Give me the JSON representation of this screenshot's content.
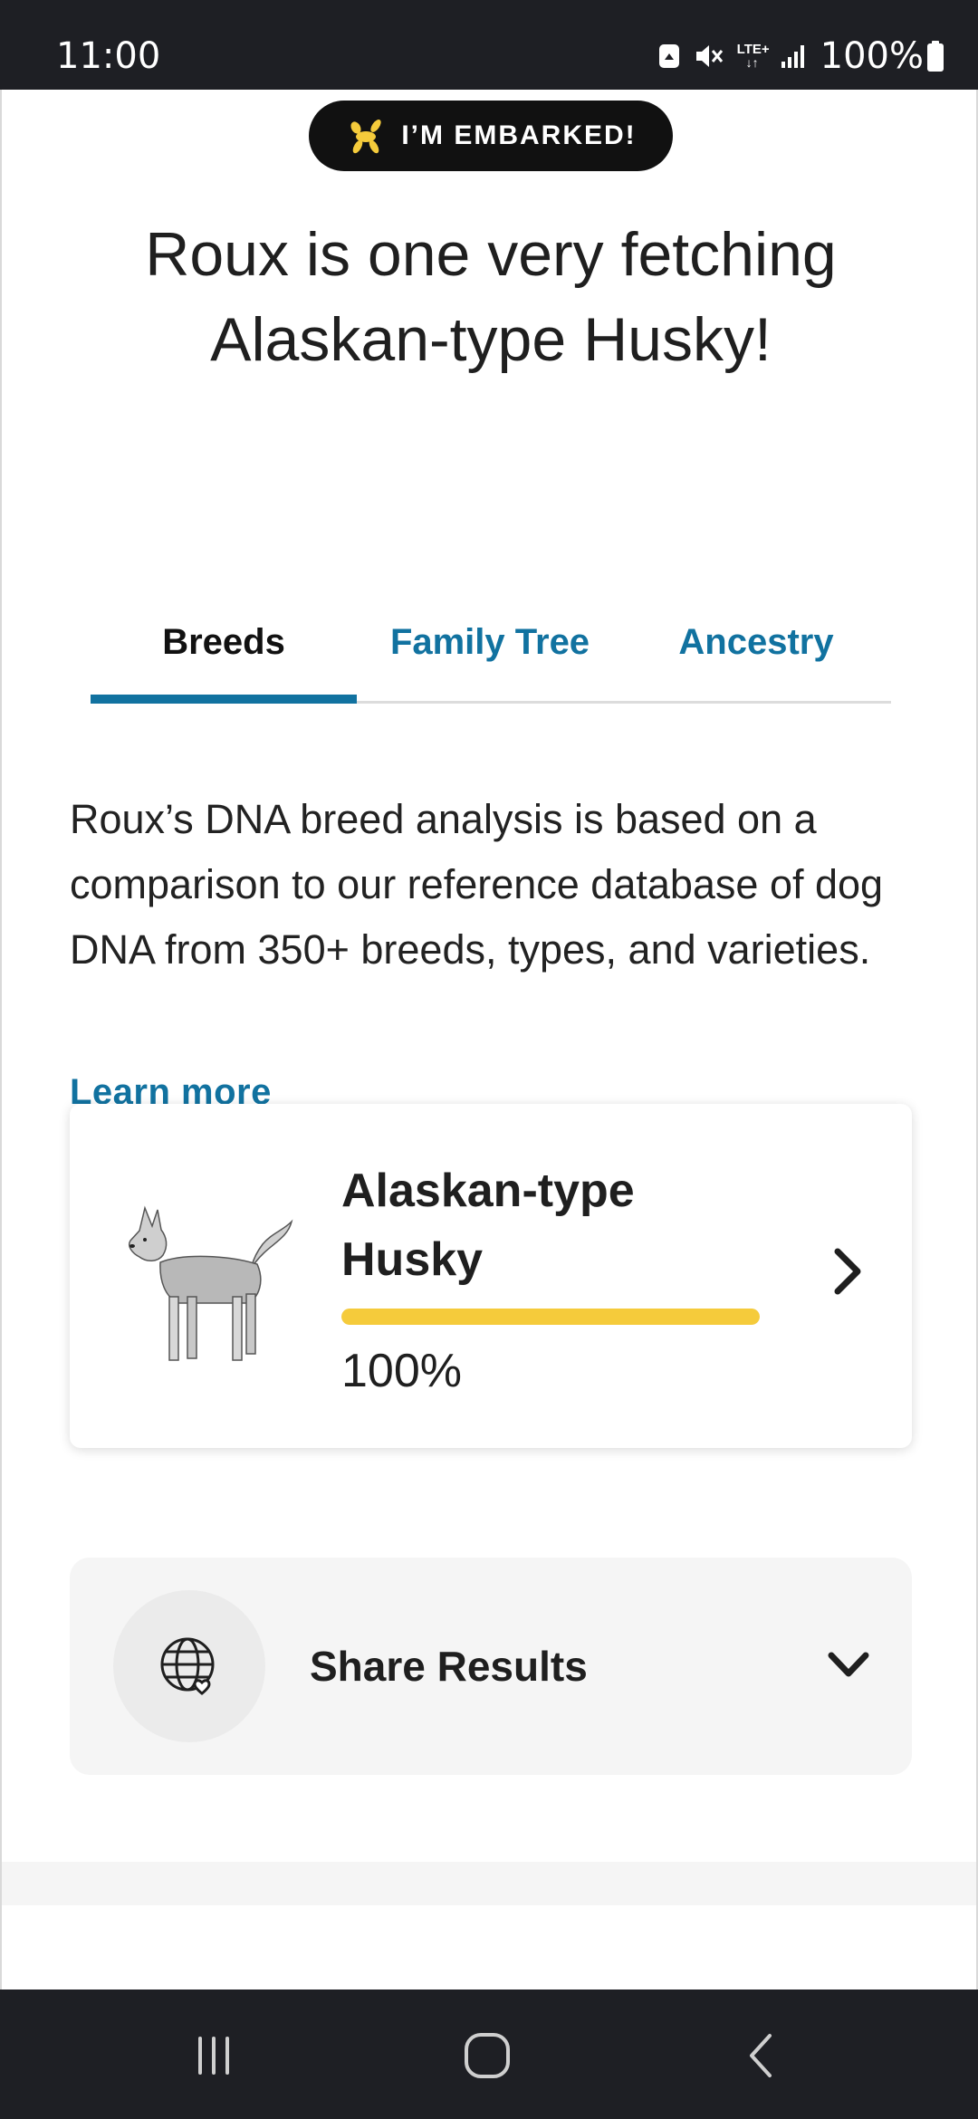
{
  "status_bar": {
    "time": "11:00",
    "battery": "100%",
    "network": "LTE+",
    "icons": [
      "screenshot-icon",
      "mute-icon",
      "lte-icon",
      "signal-icon",
      "battery-icon"
    ]
  },
  "badge": {
    "text": "I’M EMBARKED!",
    "icon": "dog-balloon-icon",
    "icon_color": "#f5cb3b"
  },
  "headline": "Roux is one very fetching Alaskan-type Husky!",
  "tabs": [
    {
      "label": "Breeds",
      "active": true
    },
    {
      "label": "Family Tree",
      "active": false
    },
    {
      "label": "Ancestry",
      "active": false
    }
  ],
  "description": "Roux’s DNA breed analysis is based on a comparison to our reference database of dog DNA from 350+ breeds, types, and varieties.",
  "learn_more": "Learn more",
  "breed_result": {
    "name": "Alaskan-type Husky",
    "percent_label": "100%",
    "percent": 100,
    "bar_color": "#f5cb3b",
    "image": "husky-dog-illustration"
  },
  "share": {
    "label": "Share Results",
    "icon": "globe-heart-icon"
  },
  "colors": {
    "accent": "#1172a0",
    "dark": "#1e1f24"
  },
  "nav_bar": {
    "buttons": [
      "recent-apps-icon",
      "home-icon",
      "back-icon"
    ]
  }
}
